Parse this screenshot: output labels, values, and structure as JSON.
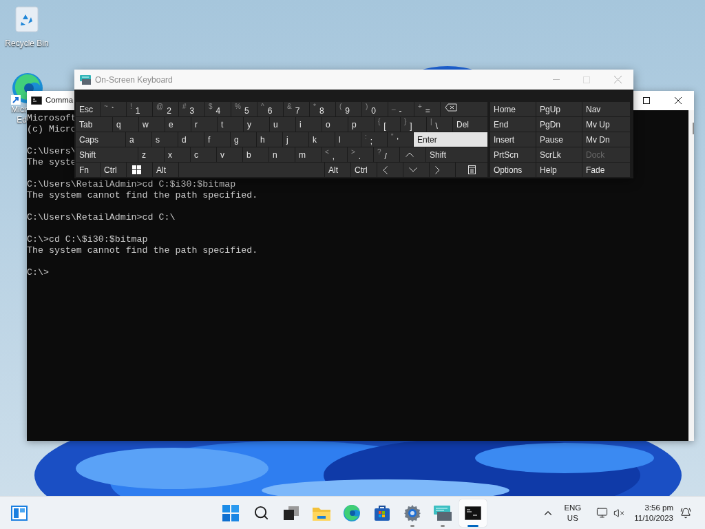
{
  "desktop_icons": [
    {
      "kind": "recycle-bin",
      "label_lines": [
        "Recycle Bin"
      ]
    },
    {
      "kind": "browser-shortcut",
      "label_lines": [
        "Micr",
        "Ed"
      ]
    }
  ],
  "cmd_window": {
    "title": "Comma",
    "blocks": [
      [
        "Microsoft",
        "(c) Micro"
      ],
      [
        "C:\\Users\\",
        "The syste"
      ],
      [
        "C:\\Users\\RetailAdmin>cd C:$i30:$bitmap",
        "The system cannot find the path specified."
      ],
      [
        "C:\\Users\\RetailAdmin>cd C:\\"
      ],
      [
        "C:\\>cd C:\\$i30:$bitmap",
        "The system cannot find the path specified."
      ],
      [
        "C:\\>"
      ]
    ]
  },
  "osk": {
    "title": "On-Screen Keyboard",
    "rows": [
      {
        "keys": [
          {
            "kind": "label",
            "label": "Esc",
            "hovered": false
          },
          {
            "kind": "dual",
            "top": "~",
            "main": "`",
            "hovered": false
          },
          {
            "kind": "dual",
            "top": "!",
            "main": "1",
            "hovered": false
          },
          {
            "kind": "dual",
            "top": "@",
            "main": "2",
            "hovered": false
          },
          {
            "kind": "dual",
            "top": "#",
            "main": "3",
            "hovered": false
          },
          {
            "kind": "dual",
            "top": "$",
            "main": "4",
            "hovered": false
          },
          {
            "kind": "dual",
            "top": "%",
            "main": "5",
            "hovered": false
          },
          {
            "kind": "dual",
            "top": "^",
            "main": "6",
            "hovered": false
          },
          {
            "kind": "dual",
            "top": "&",
            "main": "7",
            "hovered": false
          },
          {
            "kind": "dual",
            "top": "*",
            "main": "8",
            "hovered": false
          },
          {
            "kind": "dual",
            "top": "(",
            "main": "9",
            "hovered": false
          },
          {
            "kind": "dual",
            "top": ")",
            "main": "0",
            "hovered": false
          },
          {
            "kind": "dual",
            "top": "_",
            "main": "-",
            "hovered": false
          },
          {
            "kind": "dual",
            "top": "+",
            "main": "=",
            "hovered": false
          },
          {
            "kind": "backspace",
            "hovered": false
          }
        ]
      },
      {
        "keys": [
          {
            "kind": "label",
            "label": "Tab",
            "hovered": false
          },
          {
            "kind": "label",
            "label": "q",
            "hovered": false
          },
          {
            "kind": "label",
            "label": "w",
            "hovered": false
          },
          {
            "kind": "label",
            "label": "e",
            "hovered": false
          },
          {
            "kind": "label",
            "label": "r",
            "hovered": false
          },
          {
            "kind": "label",
            "label": "t",
            "hovered": false
          },
          {
            "kind": "label",
            "label": "y",
            "hovered": false
          },
          {
            "kind": "label",
            "label": "u",
            "hovered": false
          },
          {
            "kind": "label",
            "label": "i",
            "hovered": false
          },
          {
            "kind": "label",
            "label": "o",
            "hovered": false
          },
          {
            "kind": "label",
            "label": "p",
            "hovered": false
          },
          {
            "kind": "dual",
            "top": "{",
            "main": "[",
            "hovered": false
          },
          {
            "kind": "dual",
            "top": "}",
            "main": "]",
            "hovered": false
          },
          {
            "kind": "dual",
            "top": "|",
            "main": "\\",
            "hovered": false
          },
          {
            "kind": "label",
            "label": "Del",
            "hovered": false
          }
        ]
      },
      {
        "keys": [
          {
            "kind": "label",
            "label": "Caps",
            "hovered": false
          },
          {
            "kind": "label",
            "label": "a",
            "hovered": false
          },
          {
            "kind": "label",
            "label": "s",
            "hovered": false
          },
          {
            "kind": "label",
            "label": "d",
            "hovered": false
          },
          {
            "kind": "label",
            "label": "f",
            "hovered": false
          },
          {
            "kind": "label",
            "label": "g",
            "hovered": false
          },
          {
            "kind": "label",
            "label": "h",
            "hovered": false
          },
          {
            "kind": "label",
            "label": "j",
            "hovered": false
          },
          {
            "kind": "label",
            "label": "k",
            "hovered": false
          },
          {
            "kind": "label",
            "label": "l",
            "hovered": false
          },
          {
            "kind": "dual",
            "top": ":",
            "main": ";",
            "hovered": false
          },
          {
            "kind": "dual",
            "top": "\"",
            "main": "'",
            "hovered": false
          },
          {
            "kind": "label",
            "label": "Enter",
            "hovered": true
          }
        ]
      },
      {
        "keys": [
          {
            "kind": "label",
            "label": "Shift",
            "hovered": false
          },
          {
            "kind": "label",
            "label": "z",
            "hovered": false
          },
          {
            "kind": "label",
            "label": "x",
            "hovered": false
          },
          {
            "kind": "label",
            "label": "c",
            "hovered": false
          },
          {
            "kind": "label",
            "label": "v",
            "hovered": false
          },
          {
            "kind": "label",
            "label": "b",
            "hovered": false
          },
          {
            "kind": "label",
            "label": "n",
            "hovered": false
          },
          {
            "kind": "label",
            "label": "m",
            "hovered": false
          },
          {
            "kind": "dual",
            "top": "<",
            "main": ",",
            "hovered": false
          },
          {
            "kind": "dual",
            "top": ">",
            "main": ".",
            "hovered": false
          },
          {
            "kind": "dual",
            "top": "?",
            "main": "/",
            "hovered": false
          },
          {
            "kind": "up",
            "hovered": false
          },
          {
            "kind": "label",
            "label": "Shift",
            "hovered": false
          }
        ]
      },
      {
        "keys": [
          {
            "kind": "label",
            "label": "Fn",
            "hovered": false
          },
          {
            "kind": "label",
            "label": "Ctrl",
            "hovered": false
          },
          {
            "kind": "windows",
            "hovered": false
          },
          {
            "kind": "label",
            "label": "Alt",
            "hovered": false
          },
          {
            "kind": "space",
            "hovered": false
          },
          {
            "kind": "label",
            "label": "Alt",
            "hovered": false
          },
          {
            "kind": "label",
            "label": "Ctrl",
            "hovered": false
          },
          {
            "kind": "left",
            "hovered": false
          },
          {
            "kind": "down",
            "hovered": false
          },
          {
            "kind": "right",
            "hovered": false
          },
          {
            "kind": "menu",
            "hovered": false
          }
        ]
      }
    ],
    "side_rows": [
      [
        {
          "label": "Home",
          "disabled": false
        },
        {
          "label": "PgUp",
          "disabled": false
        },
        {
          "label": "Nav",
          "disabled": false
        }
      ],
      [
        {
          "label": "End",
          "disabled": false
        },
        {
          "label": "PgDn",
          "disabled": false
        },
        {
          "label": "Mv Up",
          "disabled": false
        }
      ],
      [
        {
          "label": "Insert",
          "disabled": false
        },
        {
          "label": "Pause",
          "disabled": false
        },
        {
          "label": "Mv Dn",
          "disabled": false
        }
      ],
      [
        {
          "label": "PrtScn",
          "disabled": false
        },
        {
          "label": "ScrLk",
          "disabled": false
        },
        {
          "label": "Dock",
          "disabled": true
        }
      ],
      [
        {
          "label": "Options",
          "disabled": false
        },
        {
          "label": "Help",
          "disabled": false
        },
        {
          "label": "Fade",
          "disabled": false
        }
      ]
    ]
  },
  "taskbar": {
    "pinned": [
      {
        "kind": "start",
        "running": false,
        "active": false
      },
      {
        "kind": "search",
        "running": false,
        "active": false
      },
      {
        "kind": "task-view",
        "running": false,
        "active": false
      },
      {
        "kind": "files",
        "running": false,
        "active": false
      },
      {
        "kind": "browser",
        "running": false,
        "active": false
      },
      {
        "kind": "store",
        "running": false,
        "active": false
      },
      {
        "kind": "settings",
        "running": true,
        "active": false
      },
      {
        "kind": "keyboard",
        "running": true,
        "active": false
      },
      {
        "kind": "terminal",
        "running": true,
        "active": true
      }
    ],
    "tray": {
      "language": "ENG",
      "region": "US",
      "time": "3:56 pm",
      "date": "11/10/2023"
    }
  }
}
